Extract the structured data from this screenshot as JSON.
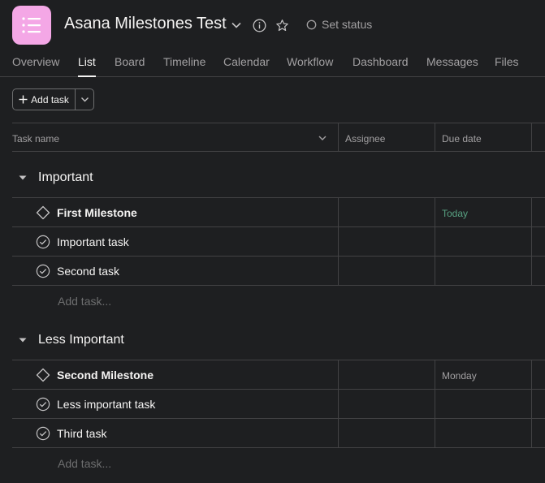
{
  "project": {
    "title": "Asana Milestones Test",
    "set_status": "Set status",
    "icon_color": "#f4a7e6"
  },
  "tabs": [
    {
      "label": "Overview",
      "active": false
    },
    {
      "label": "List",
      "active": true
    },
    {
      "label": "Board",
      "active": false
    },
    {
      "label": "Timeline",
      "active": false
    },
    {
      "label": "Calendar",
      "active": false
    },
    {
      "label": "Workflow",
      "active": false
    },
    {
      "label": "Dashboard",
      "active": false
    },
    {
      "label": "Messages",
      "active": false
    },
    {
      "label": "Files",
      "active": false
    }
  ],
  "toolbar": {
    "add_task_label": "Add task"
  },
  "columns": {
    "task_name": "Task name",
    "assignee": "Assignee",
    "due_date": "Due date"
  },
  "sections": [
    {
      "name": "Important",
      "rows": [
        {
          "name": "First Milestone",
          "type": "milestone",
          "due": "Today",
          "due_color": "#58a182"
        },
        {
          "name": "Important task",
          "type": "task",
          "due": ""
        },
        {
          "name": "Second task",
          "type": "task",
          "due": ""
        }
      ],
      "add_label": "Add task..."
    },
    {
      "name": "Less Important",
      "rows": [
        {
          "name": "Second Milestone",
          "type": "milestone",
          "due": "Monday",
          "due_color": "#a2a0a2"
        },
        {
          "name": "Less important task",
          "type": "task",
          "due": ""
        },
        {
          "name": "Third task",
          "type": "task",
          "due": ""
        }
      ],
      "add_label": "Add task..."
    }
  ]
}
